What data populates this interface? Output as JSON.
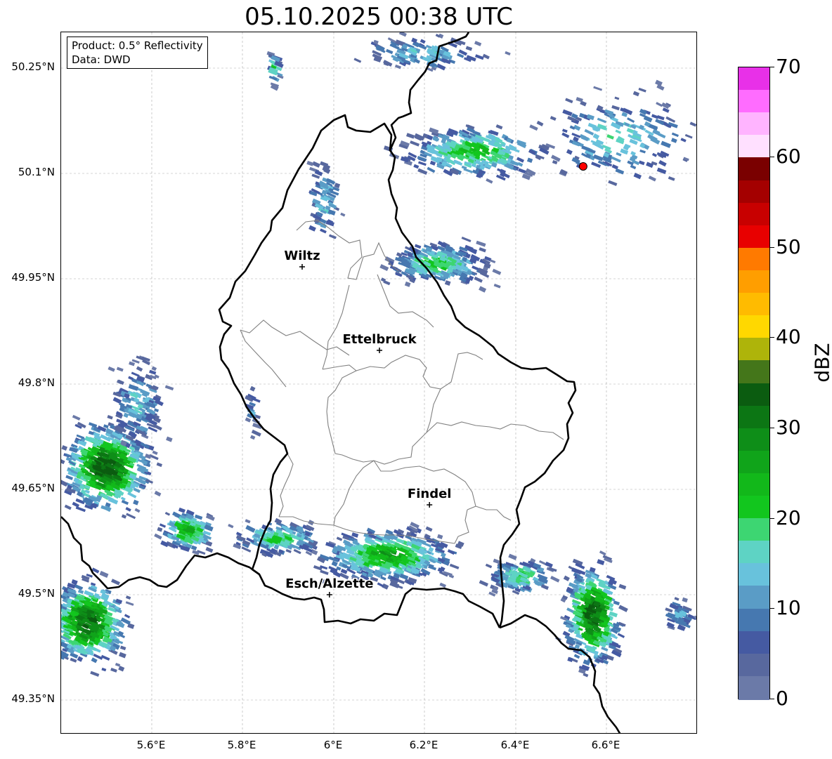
{
  "title": "05.10.2025 00:38 UTC",
  "info": {
    "product": "Product: 0.5° Reflectivity",
    "data": "Data: DWD"
  },
  "lat_labels": [
    "50.25°N",
    "50.1°N",
    "49.95°N",
    "49.8°N",
    "49.65°N",
    "49.5°N",
    "49.35°N"
  ],
  "lon_labels": [
    "5.6°E",
    "5.8°E",
    "6°E",
    "6.2°E",
    "6.4°E",
    "6.6°E"
  ],
  "cities": [
    {
      "name": "Wiltz",
      "lon": 5.93,
      "lat": 49.966
    },
    {
      "name": "Ettelbruck",
      "lon": 6.1,
      "lat": 49.847
    },
    {
      "name": "Findel",
      "lon": 6.21,
      "lat": 49.627
    },
    {
      "name": "Esch/Alzette",
      "lon": 5.99,
      "lat": 49.499
    }
  ],
  "radar_site": {
    "lon": 6.548,
    "lat": 50.109,
    "color": "#ff0000"
  },
  "colorbar": {
    "label": "dBZ",
    "ticks": [
      "0",
      "10",
      "20",
      "30",
      "40",
      "50",
      "60",
      "70"
    ],
    "min": 0,
    "max": 70,
    "step": 2.5,
    "colors": [
      "#6b7aa8",
      "#58689e",
      "#455aa2",
      "#4678b0",
      "#5a9cc6",
      "#68c2dc",
      "#5ed3c4",
      "#3dd672",
      "#12c61e",
      "#12b81a",
      "#10a41a",
      "#0e8e18",
      "#0c7614",
      "#0b5c10",
      "#44761a",
      "#aeb40a",
      "#ffd800",
      "#ffbb00",
      "#ff9e00",
      "#ff7a00",
      "#e80000",
      "#c80000",
      "#a40000",
      "#7a0000",
      "#ffe0ff",
      "#ffb4ff",
      "#ff6cff",
      "#e830e8"
    ]
  },
  "extent": {
    "lon": [
      5.4,
      6.8
    ],
    "lat": [
      49.3,
      50.3
    ]
  },
  "echoes": [
    {
      "lon": 5.5,
      "lat": 49.68,
      "slon": 0.08,
      "slat": 0.05,
      "peak": 34,
      "n": 520
    },
    {
      "lon": 5.46,
      "lat": 49.46,
      "slon": 0.07,
      "slat": 0.05,
      "peak": 32,
      "n": 420
    },
    {
      "lon": 5.68,
      "lat": 49.59,
      "slon": 0.05,
      "slat": 0.025,
      "peak": 24,
      "n": 140
    },
    {
      "lon": 5.88,
      "lat": 49.58,
      "slon": 0.08,
      "slat": 0.02,
      "peak": 20,
      "n": 160
    },
    {
      "lon": 6.12,
      "lat": 49.555,
      "slon": 0.12,
      "slat": 0.03,
      "peak": 26,
      "n": 420
    },
    {
      "lon": 6.41,
      "lat": 49.525,
      "slon": 0.06,
      "slat": 0.02,
      "peak": 20,
      "n": 120
    },
    {
      "lon": 6.57,
      "lat": 49.47,
      "slon": 0.05,
      "slat": 0.06,
      "peak": 33,
      "n": 360
    },
    {
      "lon": 6.76,
      "lat": 49.47,
      "slon": 0.03,
      "slat": 0.02,
      "peak": 12,
      "n": 50
    },
    {
      "lon": 6.23,
      "lat": 49.97,
      "slon": 0.09,
      "slat": 0.025,
      "peak": 20,
      "n": 260
    },
    {
      "lon": 6.31,
      "lat": 50.13,
      "slon": 0.13,
      "slat": 0.03,
      "peak": 22,
      "n": 280
    },
    {
      "lon": 6.63,
      "lat": 50.15,
      "slon": 0.14,
      "slat": 0.05,
      "peak": 16,
      "n": 180
    },
    {
      "lon": 5.57,
      "lat": 49.77,
      "slon": 0.05,
      "slat": 0.05,
      "peak": 14,
      "n": 140
    },
    {
      "lon": 5.98,
      "lat": 50.06,
      "slon": 0.03,
      "slat": 0.05,
      "peak": 14,
      "n": 70
    },
    {
      "lon": 6.2,
      "lat": 50.27,
      "slon": 0.12,
      "slat": 0.02,
      "peak": 14,
      "n": 100
    },
    {
      "lon": 5.87,
      "lat": 50.25,
      "slon": 0.01,
      "slat": 0.02,
      "peak": 20,
      "n": 25
    },
    {
      "lon": 5.82,
      "lat": 49.76,
      "slon": 0.01,
      "slat": 0.03,
      "peak": 12,
      "n": 20
    }
  ]
}
